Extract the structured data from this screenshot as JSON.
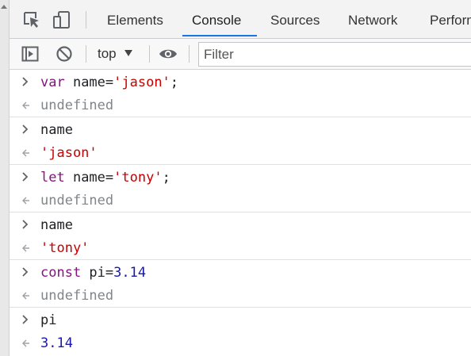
{
  "tabs": [
    {
      "label": "Elements",
      "active": false
    },
    {
      "label": "Console",
      "active": true
    },
    {
      "label": "Sources",
      "active": false
    },
    {
      "label": "Network",
      "active": false
    },
    {
      "label": "Perform",
      "active": false
    }
  ],
  "toolbar": {
    "context_label": "top",
    "filter_placeholder": "Filter"
  },
  "console": {
    "entries": [
      {
        "input": {
          "pre": "var",
          "mid": " name=",
          "str": "'jason'",
          "post": ";"
        },
        "output": "undefined"
      },
      {
        "input": {
          "text": "name"
        },
        "output_str": "'jason'"
      },
      {
        "input": {
          "pre": "let",
          "mid": " name=",
          "str": "'tony'",
          "post": ";"
        },
        "output": "undefined"
      },
      {
        "input": {
          "text": "name"
        },
        "output_str": "'tony'"
      },
      {
        "input": {
          "pre": "const",
          "mid": " pi=",
          "num": "3.14"
        },
        "output": "undefined"
      },
      {
        "input": {
          "text": "pi"
        },
        "output_num": "3.14"
      }
    ]
  },
  "colors": {
    "keyword": "#881280",
    "string": "#c80000",
    "number": "#1a1aa6",
    "undefined": "#80868b",
    "tab_active_underline": "#1a73e8"
  }
}
